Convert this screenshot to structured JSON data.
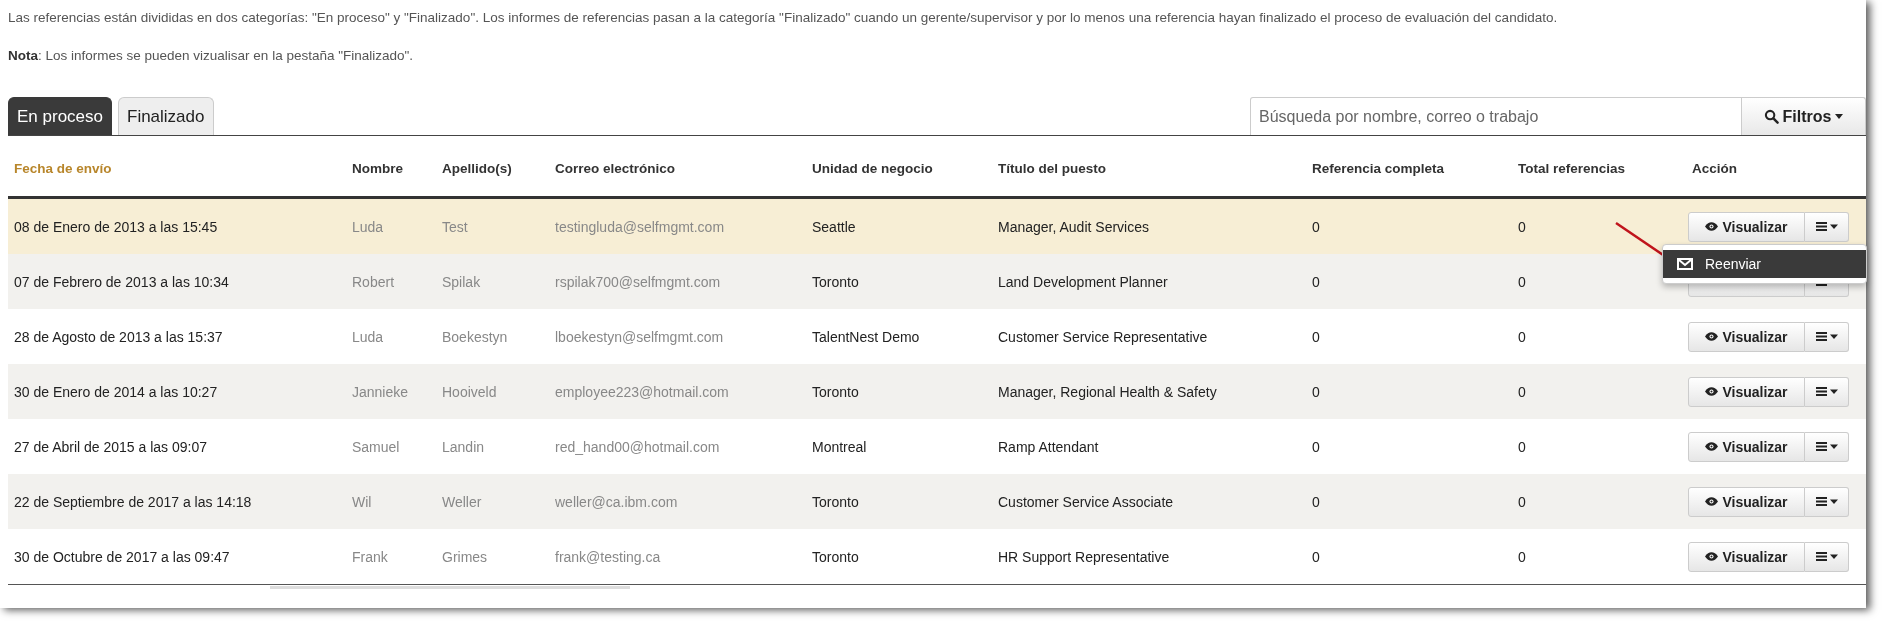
{
  "intro": "Las referencias están divididas en dos categorías: \"En proceso\" y \"Finalizado\". Los informes de referencias pasan a la categoría \"Finalizado\" cuando un gerente/supervisor y por lo menos una referencia hayan finalizado el proceso de evaluación del candidato.",
  "note": "**Nota**: Los informes se pueden vizualisar en la pestaña \"Finalizado\".",
  "tabs": [
    {
      "label": "En proceso",
      "selected": true
    },
    {
      "label": "Finalizado",
      "selected": false
    }
  ],
  "search": {
    "placeholder": "Búsqueda por nombre, correo o trabajo"
  },
  "filter_button": "Filtros",
  "table": {
    "columns": [
      {
        "label": "Fecha de envío",
        "sorted": true
      },
      {
        "label": "Nombre",
        "sorted": false
      },
      {
        "label": "Apellido(s)",
        "sorted": false
      },
      {
        "label": "Correo electrónico",
        "sorted": false
      },
      {
        "label": "Unidad de negocio",
        "sorted": false
      },
      {
        "label": "Título del puesto",
        "sorted": false
      },
      {
        "label": "Referencia completa",
        "sorted": false
      },
      {
        "label": "Total referencias",
        "sorted": false
      },
      {
        "label": "Acción",
        "sorted": false
      }
    ],
    "rows": [
      {
        "cells": [
          "08 de Enero de 2013 a las 15:45",
          "Luda",
          "Test",
          "testingluda@selfmgmt.com",
          "Seattle",
          "Manager, Audit Services",
          "0",
          "0"
        ],
        "highlighted": true,
        "view_label": "Visualizar"
      },
      {
        "cells": [
          "07 de Febrero de 2013 a las 10:34",
          "Robert",
          "Spilak",
          "rspilak700@selfmgmt.com",
          "Toronto",
          "Land Development Planner",
          "0",
          "0"
        ],
        "highlighted": false
      },
      {
        "cells": [
          "28 de Agosto de 2013 a las 15:37",
          "Luda",
          "Boekestyn",
          "lboekestyn@selfmgmt.com",
          "TalentNest Demo",
          "Customer Service Representative",
          "0",
          "0"
        ],
        "highlighted": false,
        "view_label": "Visualizar"
      },
      {
        "cells": [
          "30 de Enero de 2014 a las 10:27",
          "Jannieke",
          "Hooiveld",
          "employee223@hotmail.com",
          "Toronto",
          "Manager, Regional Health & Safety",
          "0",
          "0"
        ],
        "highlighted": false,
        "view_label": "Visualizar"
      },
      {
        "cells": [
          "27 de Abril de 2015 a las 09:07",
          "Samuel",
          "Landin",
          "red_hand00@hotmail.com",
          "Montreal",
          "Ramp Attendant",
          "0",
          "0"
        ],
        "highlighted": false,
        "view_label": "Visualizar"
      },
      {
        "cells": [
          "22 de Septiembre de 2017 a las 14:18",
          "Wil",
          "Weller",
          "weller@ca.ibm.com",
          "Toronto",
          "Customer Service Associate",
          "0",
          "0"
        ],
        "highlighted": false,
        "view_label": "Visualizar"
      },
      {
        "cells": [
          "30 de Octubre de 2017 a las 09:47",
          "Frank",
          "Grimes",
          "frank@testing.ca",
          "Toronto",
          "HR Support Representative",
          "0",
          "0"
        ],
        "highlighted": false,
        "view_label": "Visualizar"
      }
    ]
  },
  "menu": {
    "items": [
      {
        "label": "Reenviar",
        "selected": true
      }
    ]
  }
}
